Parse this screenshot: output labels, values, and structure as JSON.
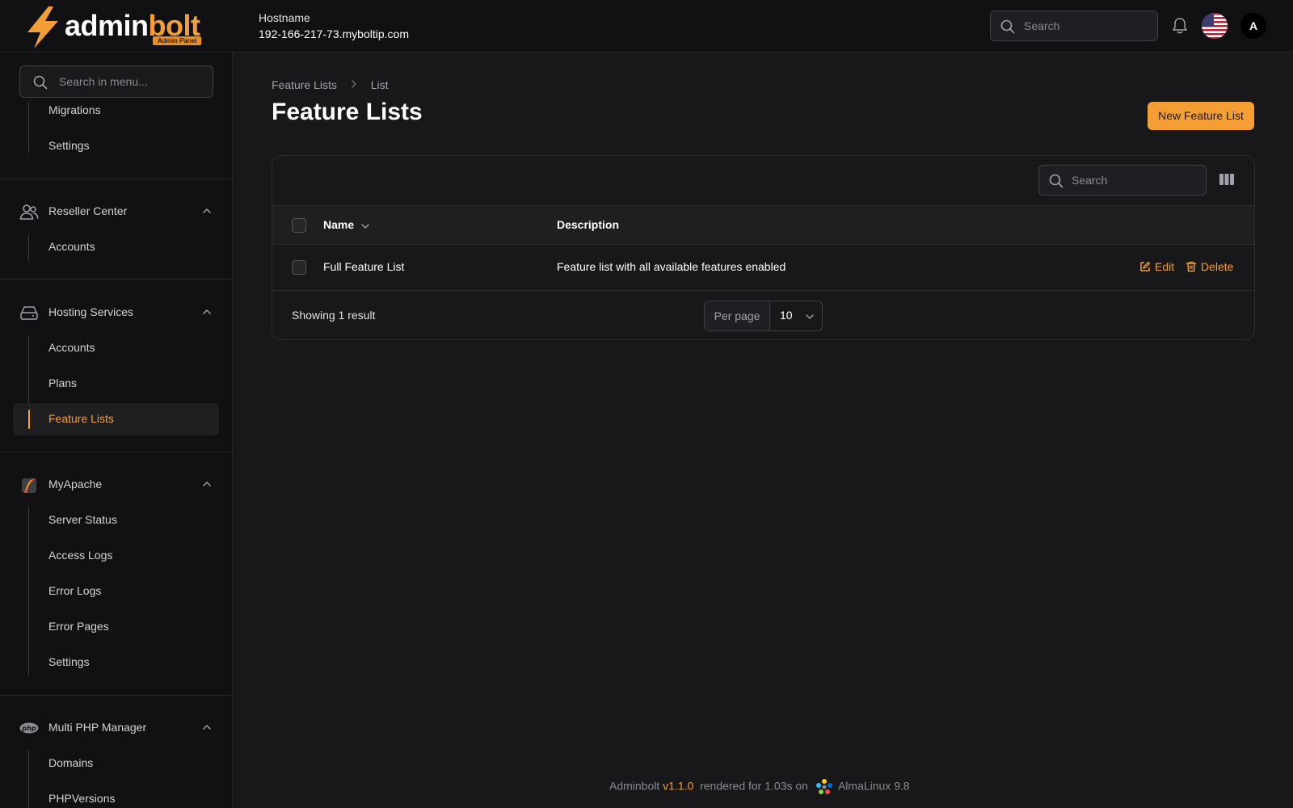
{
  "header": {
    "brand_part1": "admin",
    "brand_part2": "bolt",
    "brand_badge": "Admin Panel",
    "hostname_label": "Hostname",
    "hostname_value": "192-166-217-73.myboltip.com",
    "search_placeholder": "Search",
    "avatar_initial": "A"
  },
  "sidebar": {
    "search_placeholder": "Search in menu...",
    "top_items": [
      {
        "label": "Migrations"
      },
      {
        "label": "Settings"
      }
    ],
    "groups": [
      {
        "label": "Reseller Center",
        "icon": "users-icon",
        "items": [
          {
            "label": "Accounts"
          }
        ]
      },
      {
        "label": "Hosting Services",
        "icon": "server-icon",
        "items": [
          {
            "label": "Accounts"
          },
          {
            "label": "Plans"
          },
          {
            "label": "Feature Lists",
            "active": true
          }
        ]
      },
      {
        "label": "MyApache",
        "icon": "apache-feather-icon",
        "items": [
          {
            "label": "Server Status"
          },
          {
            "label": "Access Logs"
          },
          {
            "label": "Error Logs"
          },
          {
            "label": "Error Pages"
          },
          {
            "label": "Settings"
          }
        ]
      },
      {
        "label": "Multi PHP Manager",
        "icon": "php-icon",
        "items": [
          {
            "label": "Domains"
          },
          {
            "label": "PHPVersions"
          }
        ]
      }
    ]
  },
  "main": {
    "breadcrumb": [
      "Feature Lists",
      "List"
    ],
    "title": "Feature Lists",
    "new_button": "New Feature List",
    "table": {
      "search_placeholder": "Search",
      "columns": [
        "Name",
        "Description"
      ],
      "rows": [
        {
          "name": "Full Feature List",
          "description": "Feature list with all available features enabled"
        }
      ],
      "actions": {
        "edit": "Edit",
        "delete": "Delete"
      },
      "showing": "Showing 1 result",
      "per_page_label": "Per page",
      "per_page_value": "10"
    }
  },
  "footer": {
    "app": "Adminbolt",
    "version": "v1.1.0",
    "rendered": "rendered for 1.03s on",
    "os": "AlmaLinux 9.8"
  },
  "colors": {
    "accent": "#f59e33",
    "background": "#18181b",
    "surface": "#111113"
  }
}
